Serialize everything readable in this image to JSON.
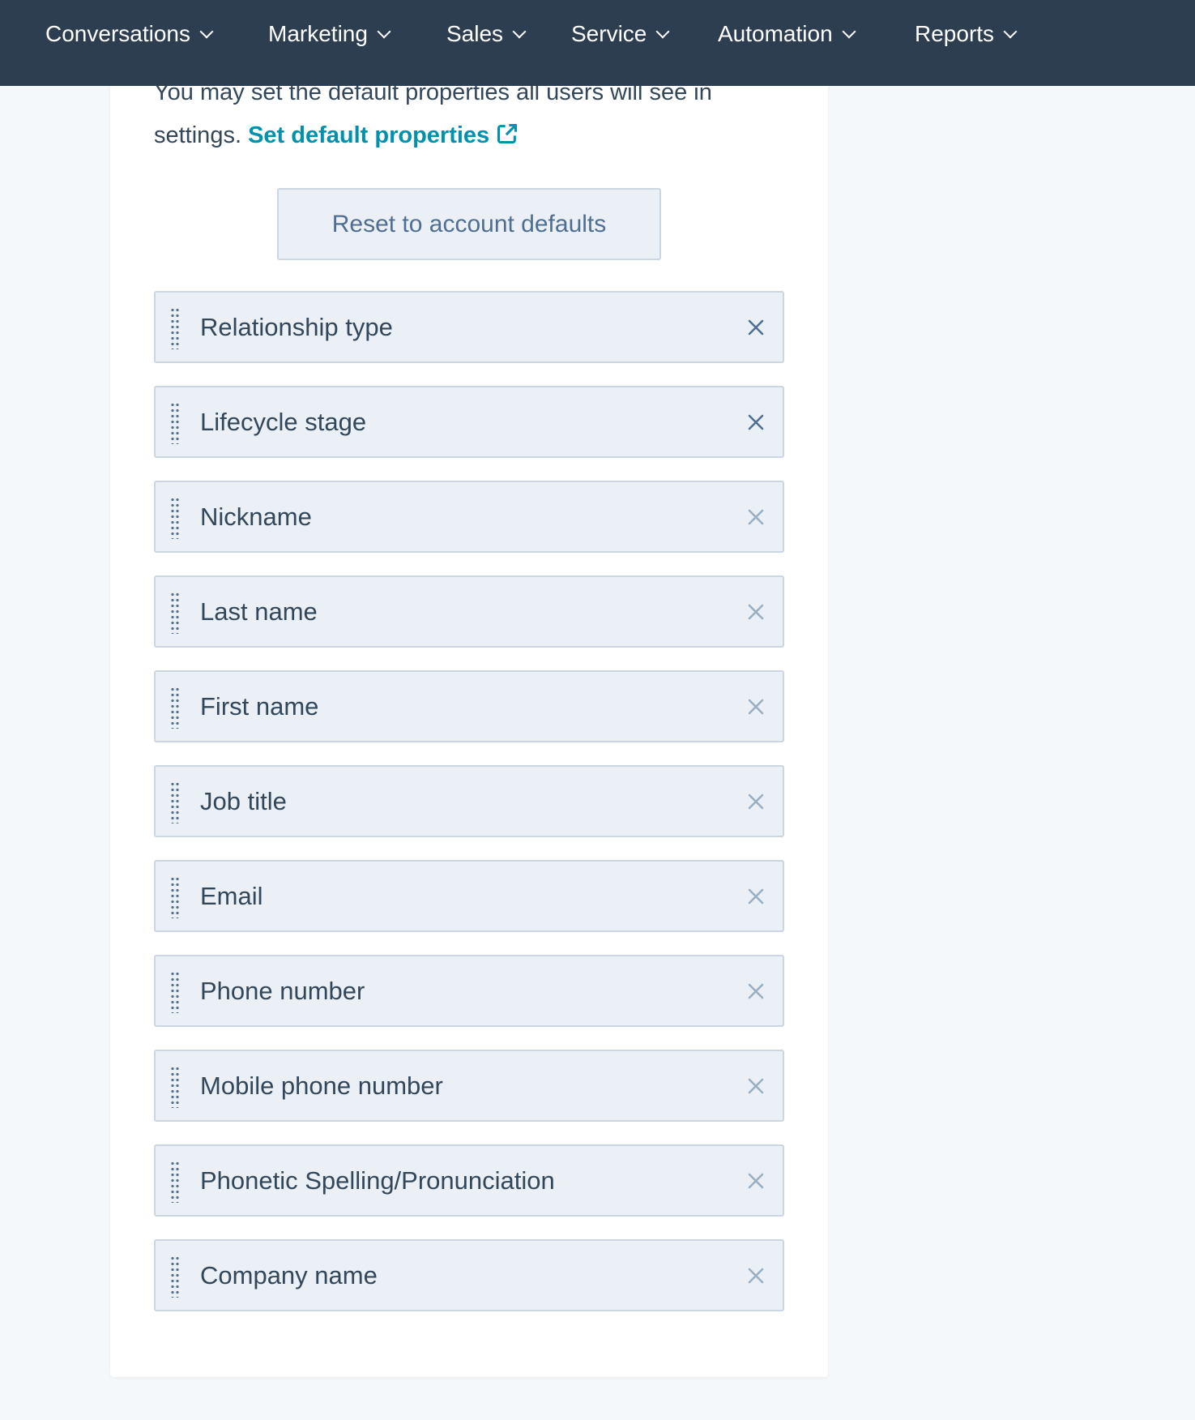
{
  "nav": {
    "items": [
      "Conversations",
      "Marketing",
      "Sales",
      "Service",
      "Automation",
      "Reports"
    ]
  },
  "intro": {
    "text_line1": "You may set the default properties all users will see in",
    "text_prefix": "settings.",
    "link_label": "Set default properties",
    "link_icon": "external-link-icon"
  },
  "reset_button": "Reset to account defaults",
  "colors": {
    "nav_bg": "#2d3e50",
    "link": "#0091ae",
    "item_bg": "#eaf0f6",
    "remove_icon": "#99afc4",
    "remove_icon_active": "#516f90"
  },
  "properties": [
    {
      "label": "Relationship type",
      "remove_active": true
    },
    {
      "label": "Lifecycle stage",
      "remove_active": true
    },
    {
      "label": "Nickname",
      "remove_active": false
    },
    {
      "label": "Last name",
      "remove_active": false
    },
    {
      "label": "First name",
      "remove_active": false
    },
    {
      "label": "Job title",
      "remove_active": false
    },
    {
      "label": "Email",
      "remove_active": false
    },
    {
      "label": "Phone number",
      "remove_active": false
    },
    {
      "label": "Mobile phone number",
      "remove_active": false
    },
    {
      "label": "Phonetic Spelling/Pronunciation",
      "remove_active": false
    },
    {
      "label": "Company name",
      "remove_active": false
    }
  ]
}
